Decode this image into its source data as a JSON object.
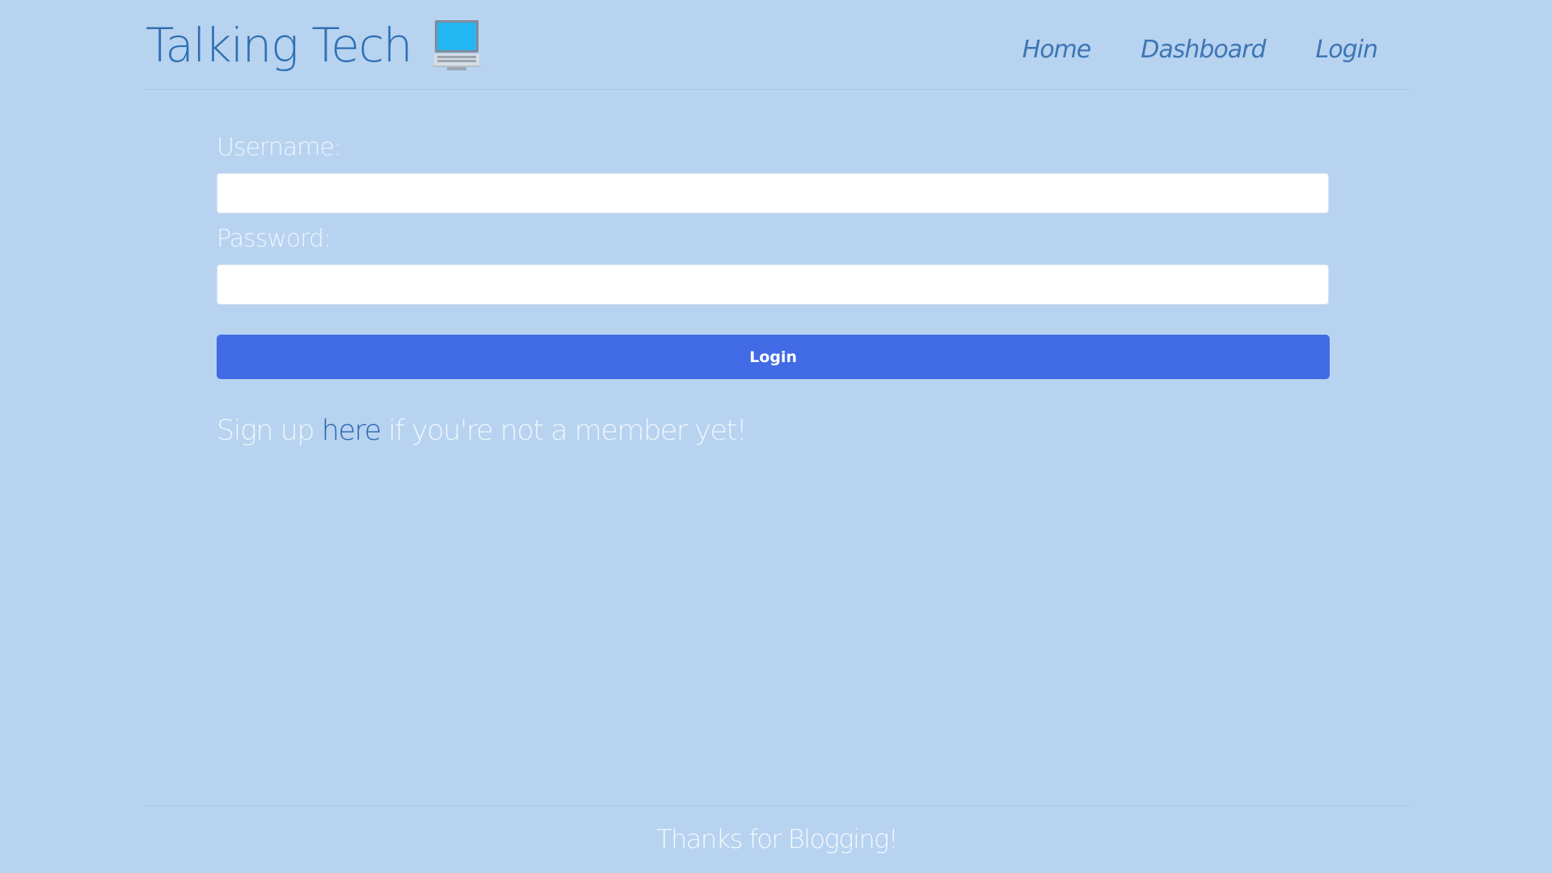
{
  "header": {
    "brand_title": "Talking Tech",
    "brand_icon": "laptop-icon",
    "nav": {
      "home": "Home",
      "dashboard": "Dashboard",
      "login": "Login"
    }
  },
  "login_form": {
    "username_label": "Username:",
    "username_value": "",
    "password_label": "Password:",
    "password_value": "",
    "submit_label": "Login",
    "accent_color": "#416be4"
  },
  "signup": {
    "prefix": "Sign up ",
    "link_text": "here",
    "suffix": " if you're not a member yet!"
  },
  "footer": {
    "text": "Thanks for Blogging!"
  },
  "colors": {
    "background": "#b7d3f0",
    "brand": "#2f6fb3"
  }
}
